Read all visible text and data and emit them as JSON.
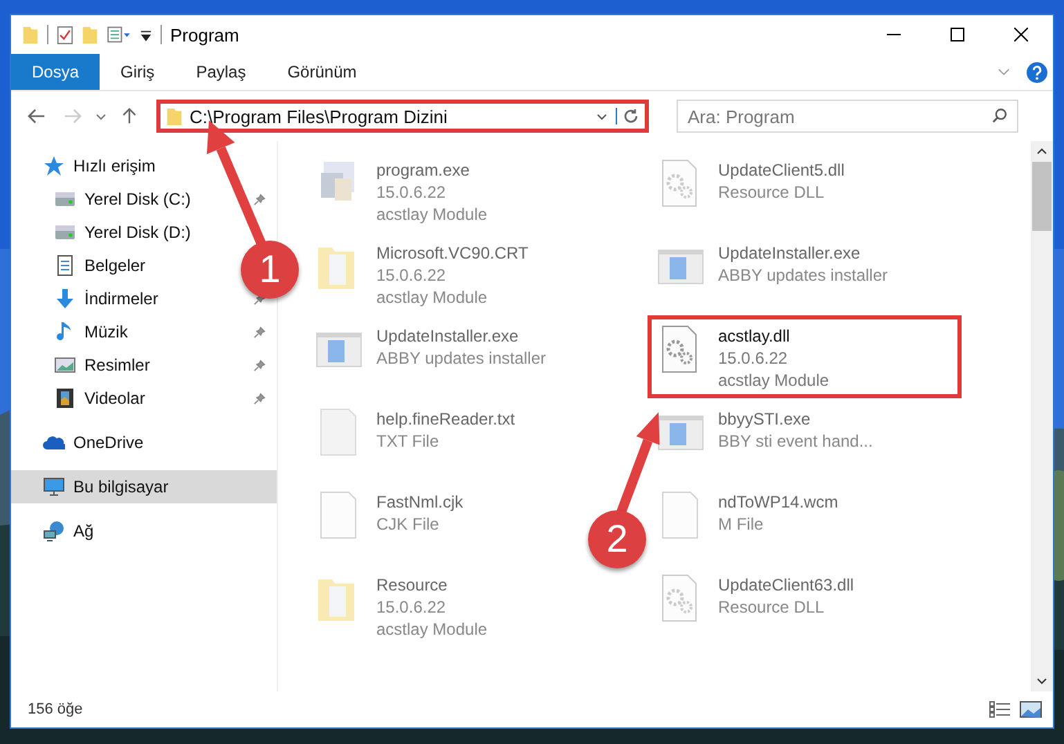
{
  "window": {
    "title": "Program"
  },
  "ribbon_tabs": [
    {
      "label": "Dosya",
      "selected": true
    },
    {
      "label": "Giriş",
      "selected": false
    },
    {
      "label": "Paylaş",
      "selected": false
    },
    {
      "label": "Görünüm",
      "selected": false
    }
  ],
  "address_bar": {
    "path": "C:\\Program Files\\Program Dizini",
    "highlighted": true
  },
  "search": {
    "placeholder": "Ara: Program"
  },
  "nav_pane": {
    "items": [
      {
        "label": "Hızlı erişim",
        "kind": "star",
        "selected": false,
        "children": [
          {
            "label": "Yerel Disk (C:)",
            "kind": "drive",
            "pinned": true,
            "selected": false
          },
          {
            "label": "Yerel Disk (D:)",
            "kind": "drive",
            "pinned": false,
            "selected": false
          },
          {
            "label": "Belgeler",
            "kind": "document",
            "pinned": false,
            "selected": false
          },
          {
            "label": "İndirmeler",
            "kind": "download",
            "pinned": true,
            "selected": false
          },
          {
            "label": "Müzik",
            "kind": "music",
            "pinned": true,
            "selected": false
          },
          {
            "label": "Resimler",
            "kind": "pictures",
            "pinned": true,
            "selected": false
          },
          {
            "label": "Videolar",
            "kind": "video",
            "pinned": true,
            "selected": false
          }
        ]
      },
      {
        "label": "OneDrive",
        "kind": "cloud",
        "selected": false
      },
      {
        "label": "Bu bilgisayar",
        "kind": "computer",
        "selected": true
      },
      {
        "label": "Ağ",
        "kind": "network",
        "selected": false
      }
    ]
  },
  "files": [
    {
      "kind": "exe",
      "lines": [
        "program.exe",
        "15.0.6.22",
        "acstlay Module"
      ],
      "dimmed": true,
      "highlighted": false
    },
    {
      "kind": "dll",
      "lines": [
        "UpdateClient5.dll",
        "Resource DLL"
      ],
      "dimmed": true,
      "highlighted": false
    },
    {
      "kind": "folder",
      "lines": [
        "Microsoft.VC90.CRT",
        "15.0.6.22",
        "acstlay Module"
      ],
      "dimmed": true,
      "highlighted": false
    },
    {
      "kind": "installer",
      "lines": [
        "UpdateInstaller.exe",
        "ABBY updates installer"
      ],
      "dimmed": true,
      "highlighted": false
    },
    {
      "kind": "installer",
      "lines": [
        "UpdateInstaller.exe",
        "ABBY updates installer"
      ],
      "dimmed": true,
      "highlighted": false
    },
    {
      "kind": "dll",
      "lines": [
        "acstlay.dll",
        "15.0.6.22",
        "acstlay Module"
      ],
      "dimmed": false,
      "highlighted": true
    },
    {
      "kind": "txt",
      "lines": [
        "help.fineReader.txt",
        "TXT File"
      ],
      "dimmed": true,
      "highlighted": false
    },
    {
      "kind": "installer",
      "lines": [
        "bbyySTI.exe",
        "BBY sti event hand..."
      ],
      "dimmed": true,
      "highlighted": false
    },
    {
      "kind": "file",
      "lines": [
        "FastNml.cjk",
        "CJK File"
      ],
      "dimmed": true,
      "highlighted": false
    },
    {
      "kind": "file",
      "lines": [
        "ndToWP14.wcm",
        "M File"
      ],
      "dimmed": true,
      "highlighted": false
    },
    {
      "kind": "folder",
      "lines": [
        "Resource",
        "15.0.6.22",
        "acstlay Module"
      ],
      "dimmed": true,
      "highlighted": false
    },
    {
      "kind": "dll",
      "lines": [
        "UpdateClient63.dll",
        "Resource DLL"
      ],
      "dimmed": true,
      "highlighted": false
    }
  ],
  "status_bar": {
    "count": "156 öğe"
  },
  "annotations": [
    {
      "label": "1"
    },
    {
      "label": "2"
    }
  ]
}
